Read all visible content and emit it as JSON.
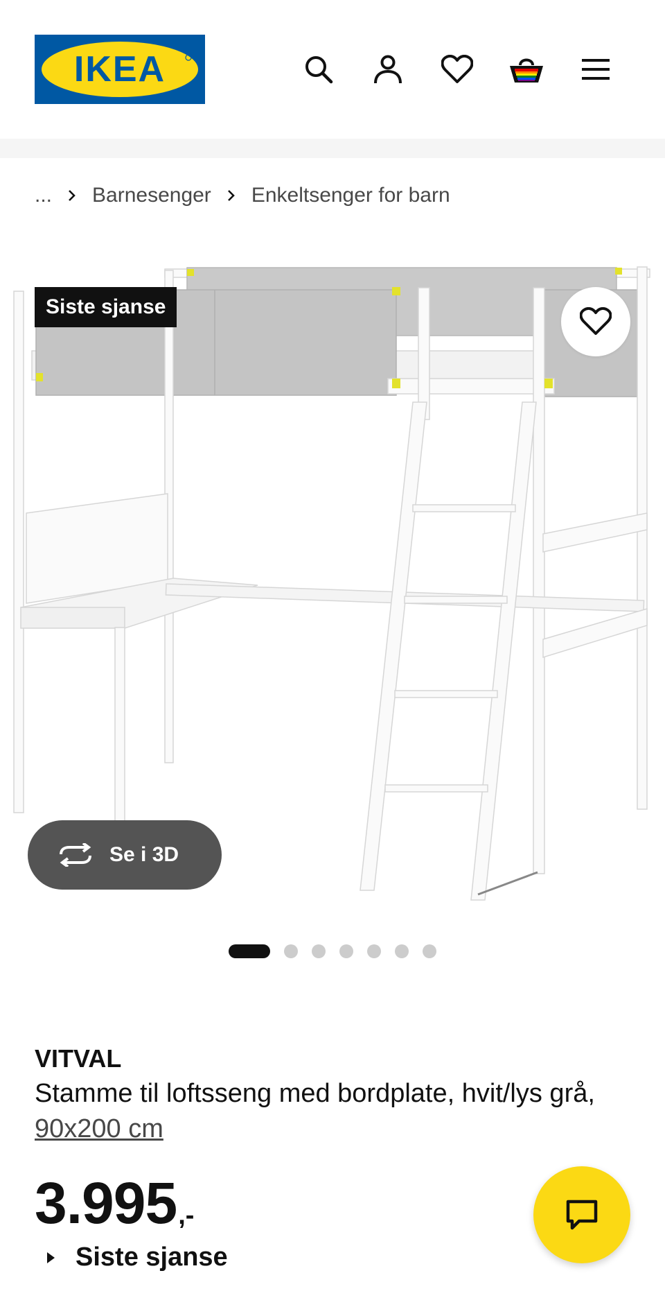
{
  "header": {
    "logo_text": "IKEA",
    "icons": [
      "search-icon",
      "account-icon",
      "favorites-icon",
      "basket-icon",
      "menu-icon"
    ]
  },
  "breadcrumb": {
    "ellipsis": "...",
    "items": [
      "Barnesenger",
      "Enkeltsenger for barn"
    ]
  },
  "gallery": {
    "badge": "Siste sjanse",
    "view3d_label": "Se i 3D",
    "image_count": 7,
    "active_index": 0
  },
  "product": {
    "name": "VITVAL",
    "description": "Stamme til loftsseng med bordplate, hvit/lys grå,",
    "size": "90x200 cm",
    "price": "3.995",
    "price_suffix": ",-",
    "status": "Siste sjanse"
  },
  "colors": {
    "ikea_blue": "#0058a3",
    "ikea_yellow": "#fbd914",
    "text": "#111111",
    "muted": "#484848"
  }
}
